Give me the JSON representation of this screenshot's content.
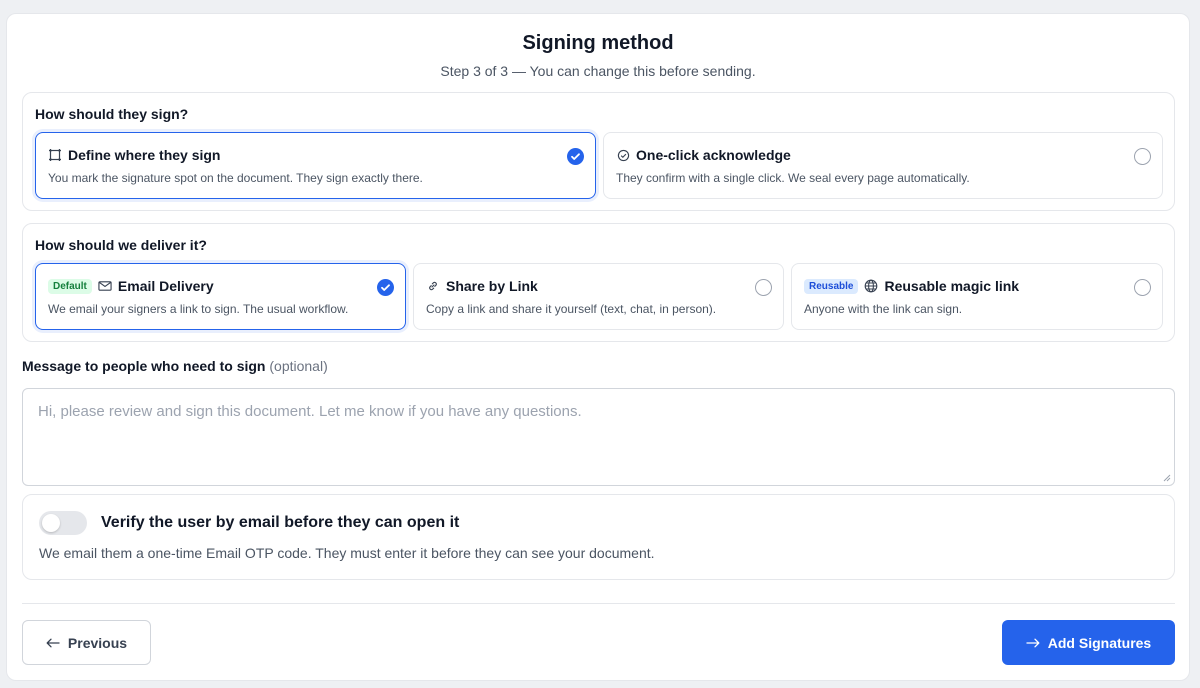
{
  "header": {
    "title": "Signing method",
    "subtitle": "Step 3 of 3 — You can change this before sending."
  },
  "sign_section": {
    "label": "How should they sign?",
    "options": [
      {
        "title": "Define where they sign",
        "desc": "You mark the signature spot on the document. They sign exactly there.",
        "selected": true,
        "icon": "frame-icon"
      },
      {
        "title": "One-click acknowledge",
        "desc": "They confirm with a single click. We seal every page automatically.",
        "selected": false,
        "icon": "check-circle-icon"
      }
    ]
  },
  "deliver_section": {
    "label": "How should we deliver it?",
    "options": [
      {
        "badge": "Default",
        "title": "Email Delivery",
        "desc": "We email your signers a link to sign. The usual workflow.",
        "selected": true,
        "icon": "mail-icon"
      },
      {
        "title": "Share by Link",
        "desc": "Copy a link and share it yourself (text, chat, in person).",
        "selected": false,
        "icon": "link-icon"
      },
      {
        "badge": "Reusable",
        "title": "Reusable magic link",
        "desc": "Anyone with the link can sign.",
        "selected": false,
        "icon": "globe-icon"
      }
    ]
  },
  "message": {
    "label": "Message to people who need to sign",
    "optional": "(optional)",
    "placeholder": "Hi, please review and sign this document. Let me know if you have any questions."
  },
  "verify": {
    "title": "Verify the user by email before they can open it",
    "desc": "We email them a one-time Email OTP code. They must enter it before they can see your document.",
    "enabled": false
  },
  "footer": {
    "previous_label": "Previous",
    "next_label": "Add Signatures"
  },
  "colors": {
    "accent": "#2563eb",
    "default_badge": "#15803d",
    "reusable_badge": "#1d4ed8"
  }
}
